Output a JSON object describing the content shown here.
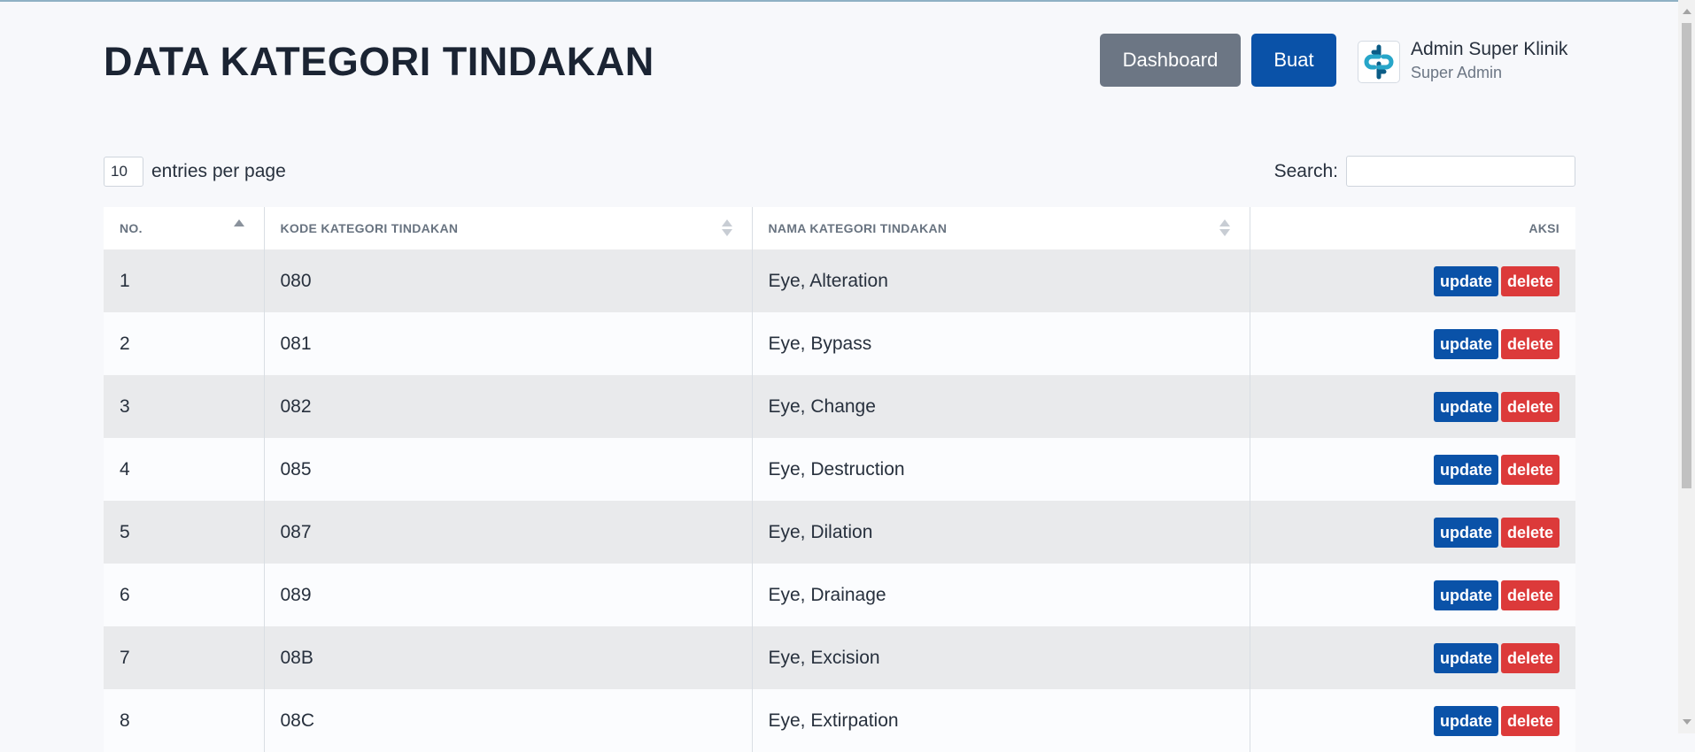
{
  "page": {
    "title": "DATA KATEGORI TINDAKAN"
  },
  "header": {
    "dashboard_label": "Dashboard",
    "create_label": "Buat",
    "user_name": "Admin Super Klinik",
    "user_role": "Super Admin",
    "avatar_icon": "clinic-logo-icon"
  },
  "controls": {
    "entries_value": "10",
    "entries_label": "entries per page",
    "search_label": "Search:",
    "search_value": ""
  },
  "table": {
    "columns": [
      "NO.",
      "KODE KATEGORI TINDAKAN",
      "NAMA KATEGORI TINDAKAN",
      "AKSI"
    ],
    "sorted_column": "NO.",
    "update_label": "update",
    "delete_label": "delete",
    "rows": [
      {
        "no": "1",
        "kode": "080",
        "nama": "Eye, Alteration"
      },
      {
        "no": "2",
        "kode": "081",
        "nama": "Eye, Bypass"
      },
      {
        "no": "3",
        "kode": "082",
        "nama": "Eye, Change"
      },
      {
        "no": "4",
        "kode": "085",
        "nama": "Eye, Destruction"
      },
      {
        "no": "5",
        "kode": "087",
        "nama": "Eye, Dilation"
      },
      {
        "no": "6",
        "kode": "089",
        "nama": "Eye, Drainage"
      },
      {
        "no": "7",
        "kode": "08B",
        "nama": "Eye, Excision"
      },
      {
        "no": "8",
        "kode": "08C",
        "nama": "Eye, Extirpation"
      }
    ]
  },
  "colors": {
    "primary": "#0a52a8",
    "secondary": "#6c7684",
    "danger": "#dc3a3a",
    "row_striped": "#e9eaec"
  }
}
